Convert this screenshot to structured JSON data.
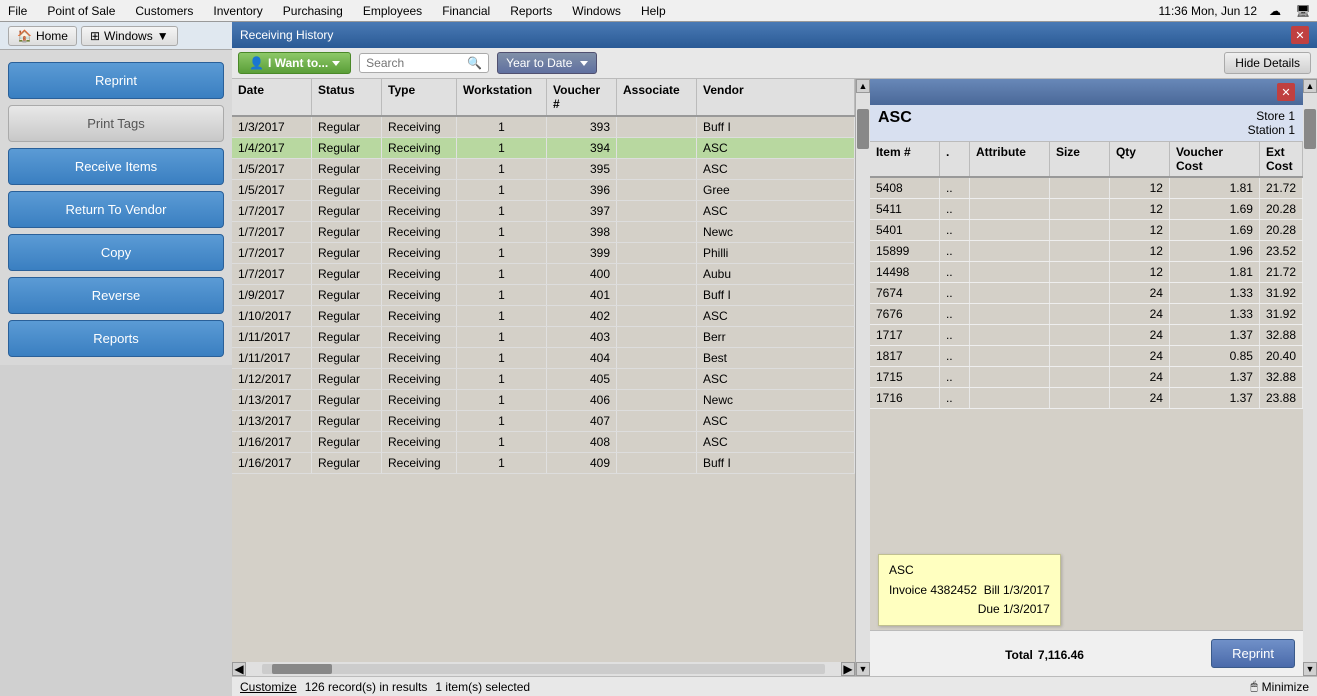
{
  "menubar": {
    "items": [
      "File",
      "Point of Sale",
      "Customers",
      "Inventory",
      "Purchasing",
      "Employees",
      "Financial",
      "Reports",
      "Windows",
      "Help"
    ],
    "clock": "11:36 Mon, Jun 12"
  },
  "sidebar": {
    "home_label": "Home",
    "windows_label": "Windows",
    "buttons": [
      {
        "id": "reprint",
        "label": "Reprint",
        "style": "blue"
      },
      {
        "id": "print-tags",
        "label": "Print Tags",
        "style": "gray"
      },
      {
        "id": "receive-items",
        "label": "Receive Items",
        "style": "blue"
      },
      {
        "id": "return-to-vendor",
        "label": "Return To Vendor",
        "style": "blue"
      },
      {
        "id": "copy",
        "label": "Copy",
        "style": "blue"
      },
      {
        "id": "reverse",
        "label": "Reverse",
        "style": "blue"
      },
      {
        "id": "reports",
        "label": "Reports",
        "style": "blue"
      }
    ]
  },
  "receiving_history": {
    "title": "Receiving History",
    "toolbar": {
      "iwant_label": "I Want to...",
      "search_placeholder": "Search",
      "date_filter": "Year to Date",
      "hide_details_label": "Hide Details"
    },
    "columns": [
      "Date",
      "Status",
      "Type",
      "Workstation",
      "Voucher #",
      "Associate",
      "Vendor"
    ],
    "rows": [
      {
        "date": "1/3/2017",
        "status": "Regular",
        "type": "Receiving",
        "workstation": "1",
        "voucher": "393",
        "associate": "",
        "vendor": "Buff I"
      },
      {
        "date": "1/4/2017",
        "status": "Regular",
        "type": "Receiving",
        "workstation": "1",
        "voucher": "394",
        "associate": "",
        "vendor": "ASC",
        "selected": true
      },
      {
        "date": "1/5/2017",
        "status": "Regular",
        "type": "Receiving",
        "workstation": "1",
        "voucher": "395",
        "associate": "",
        "vendor": "ASC"
      },
      {
        "date": "1/5/2017",
        "status": "Regular",
        "type": "Receiving",
        "workstation": "1",
        "voucher": "396",
        "associate": "",
        "vendor": "Gree"
      },
      {
        "date": "1/7/2017",
        "status": "Regular",
        "type": "Receiving",
        "workstation": "1",
        "voucher": "397",
        "associate": "",
        "vendor": "ASC"
      },
      {
        "date": "1/7/2017",
        "status": "Regular",
        "type": "Receiving",
        "workstation": "1",
        "voucher": "398",
        "associate": "",
        "vendor": "Newc"
      },
      {
        "date": "1/7/2017",
        "status": "Regular",
        "type": "Receiving",
        "workstation": "1",
        "voucher": "399",
        "associate": "",
        "vendor": "Philli"
      },
      {
        "date": "1/7/2017",
        "status": "Regular",
        "type": "Receiving",
        "workstation": "1",
        "voucher": "400",
        "associate": "",
        "vendor": "Aubu"
      },
      {
        "date": "1/9/2017",
        "status": "Regular",
        "type": "Receiving",
        "workstation": "1",
        "voucher": "401",
        "associate": "",
        "vendor": "Buff I"
      },
      {
        "date": "1/10/2017",
        "status": "Regular",
        "type": "Receiving",
        "workstation": "1",
        "voucher": "402",
        "associate": "",
        "vendor": "ASC"
      },
      {
        "date": "1/11/2017",
        "status": "Regular",
        "type": "Receiving",
        "workstation": "1",
        "voucher": "403",
        "associate": "",
        "vendor": "Berr"
      },
      {
        "date": "1/11/2017",
        "status": "Regular",
        "type": "Receiving",
        "workstation": "1",
        "voucher": "404",
        "associate": "",
        "vendor": "Best"
      },
      {
        "date": "1/12/2017",
        "status": "Regular",
        "type": "Receiving",
        "workstation": "1",
        "voucher": "405",
        "associate": "",
        "vendor": "ASC"
      },
      {
        "date": "1/13/2017",
        "status": "Regular",
        "type": "Receiving",
        "workstation": "1",
        "voucher": "406",
        "associate": "",
        "vendor": "Newc"
      },
      {
        "date": "1/13/2017",
        "status": "Regular",
        "type": "Receiving",
        "workstation": "1",
        "voucher": "407",
        "associate": "",
        "vendor": "ASC"
      },
      {
        "date": "1/16/2017",
        "status": "Regular",
        "type": "Receiving",
        "workstation": "1",
        "voucher": "408",
        "associate": "",
        "vendor": "ASC"
      },
      {
        "date": "1/16/2017",
        "status": "Regular",
        "type": "Receiving",
        "workstation": "1",
        "voucher": "409",
        "associate": "",
        "vendor": "Buff I"
      }
    ],
    "statusbar": {
      "record_count": "126 record(s) in results",
      "selected_count": "1 item(s) selected"
    }
  },
  "detail_panel": {
    "vendor_name": "ASC",
    "store": "Store 1",
    "station": "Station 1",
    "columns": [
      "Item #",
      ".",
      "Attribute",
      "Size",
      "Qty",
      "Voucher Cost",
      "Ext Cost"
    ],
    "rows": [
      {
        "item": "5408",
        "dot": "..",
        "attr": "",
        "size": "",
        "qty": "12",
        "vcost": "1.81",
        "ecost": "21.72"
      },
      {
        "item": "5411",
        "dot": "..",
        "attr": "",
        "size": "",
        "qty": "12",
        "vcost": "1.69",
        "ecost": "20.28"
      },
      {
        "item": "5401",
        "dot": "..",
        "attr": "",
        "size": "",
        "qty": "12",
        "vcost": "1.69",
        "ecost": "20.28"
      },
      {
        "item": "15899",
        "dot": "..",
        "attr": "",
        "size": "",
        "qty": "12",
        "vcost": "1.96",
        "ecost": "23.52"
      },
      {
        "item": "14498",
        "dot": "..",
        "attr": "",
        "size": "",
        "qty": "12",
        "vcost": "1.81",
        "ecost": "21.72"
      },
      {
        "item": "7674",
        "dot": "..",
        "attr": "",
        "size": "",
        "qty": "24",
        "vcost": "1.33",
        "ecost": "31.92"
      },
      {
        "item": "7676",
        "dot": "..",
        "attr": "",
        "size": "",
        "qty": "24",
        "vcost": "1.33",
        "ecost": "31.92"
      },
      {
        "item": "1717",
        "dot": "..",
        "attr": "",
        "size": "",
        "qty": "24",
        "vcost": "1.37",
        "ecost": "32.88"
      },
      {
        "item": "1817",
        "dot": "..",
        "attr": "",
        "size": "",
        "qty": "24",
        "vcost": "0.85",
        "ecost": "20.40"
      },
      {
        "item": "1715",
        "dot": "..",
        "attr": "",
        "size": "",
        "qty": "24",
        "vcost": "1.37",
        "ecost": "32.88"
      },
      {
        "item": "1716",
        "dot": "..",
        "attr": "",
        "size": "",
        "qty": "24",
        "vcost": "1.37",
        "ecost": "23.88"
      }
    ],
    "tooltip": {
      "vendor": "ASC",
      "invoice": "Invoice 4382452",
      "bill": "Bill 1/3/2017",
      "due": "Due 1/3/2017"
    },
    "total_label": "Total",
    "total_value": "7,116.46",
    "reprint_label": "Reprint"
  },
  "statusbar": {
    "customize_label": "Customize",
    "minimize_label": "Minimize"
  }
}
